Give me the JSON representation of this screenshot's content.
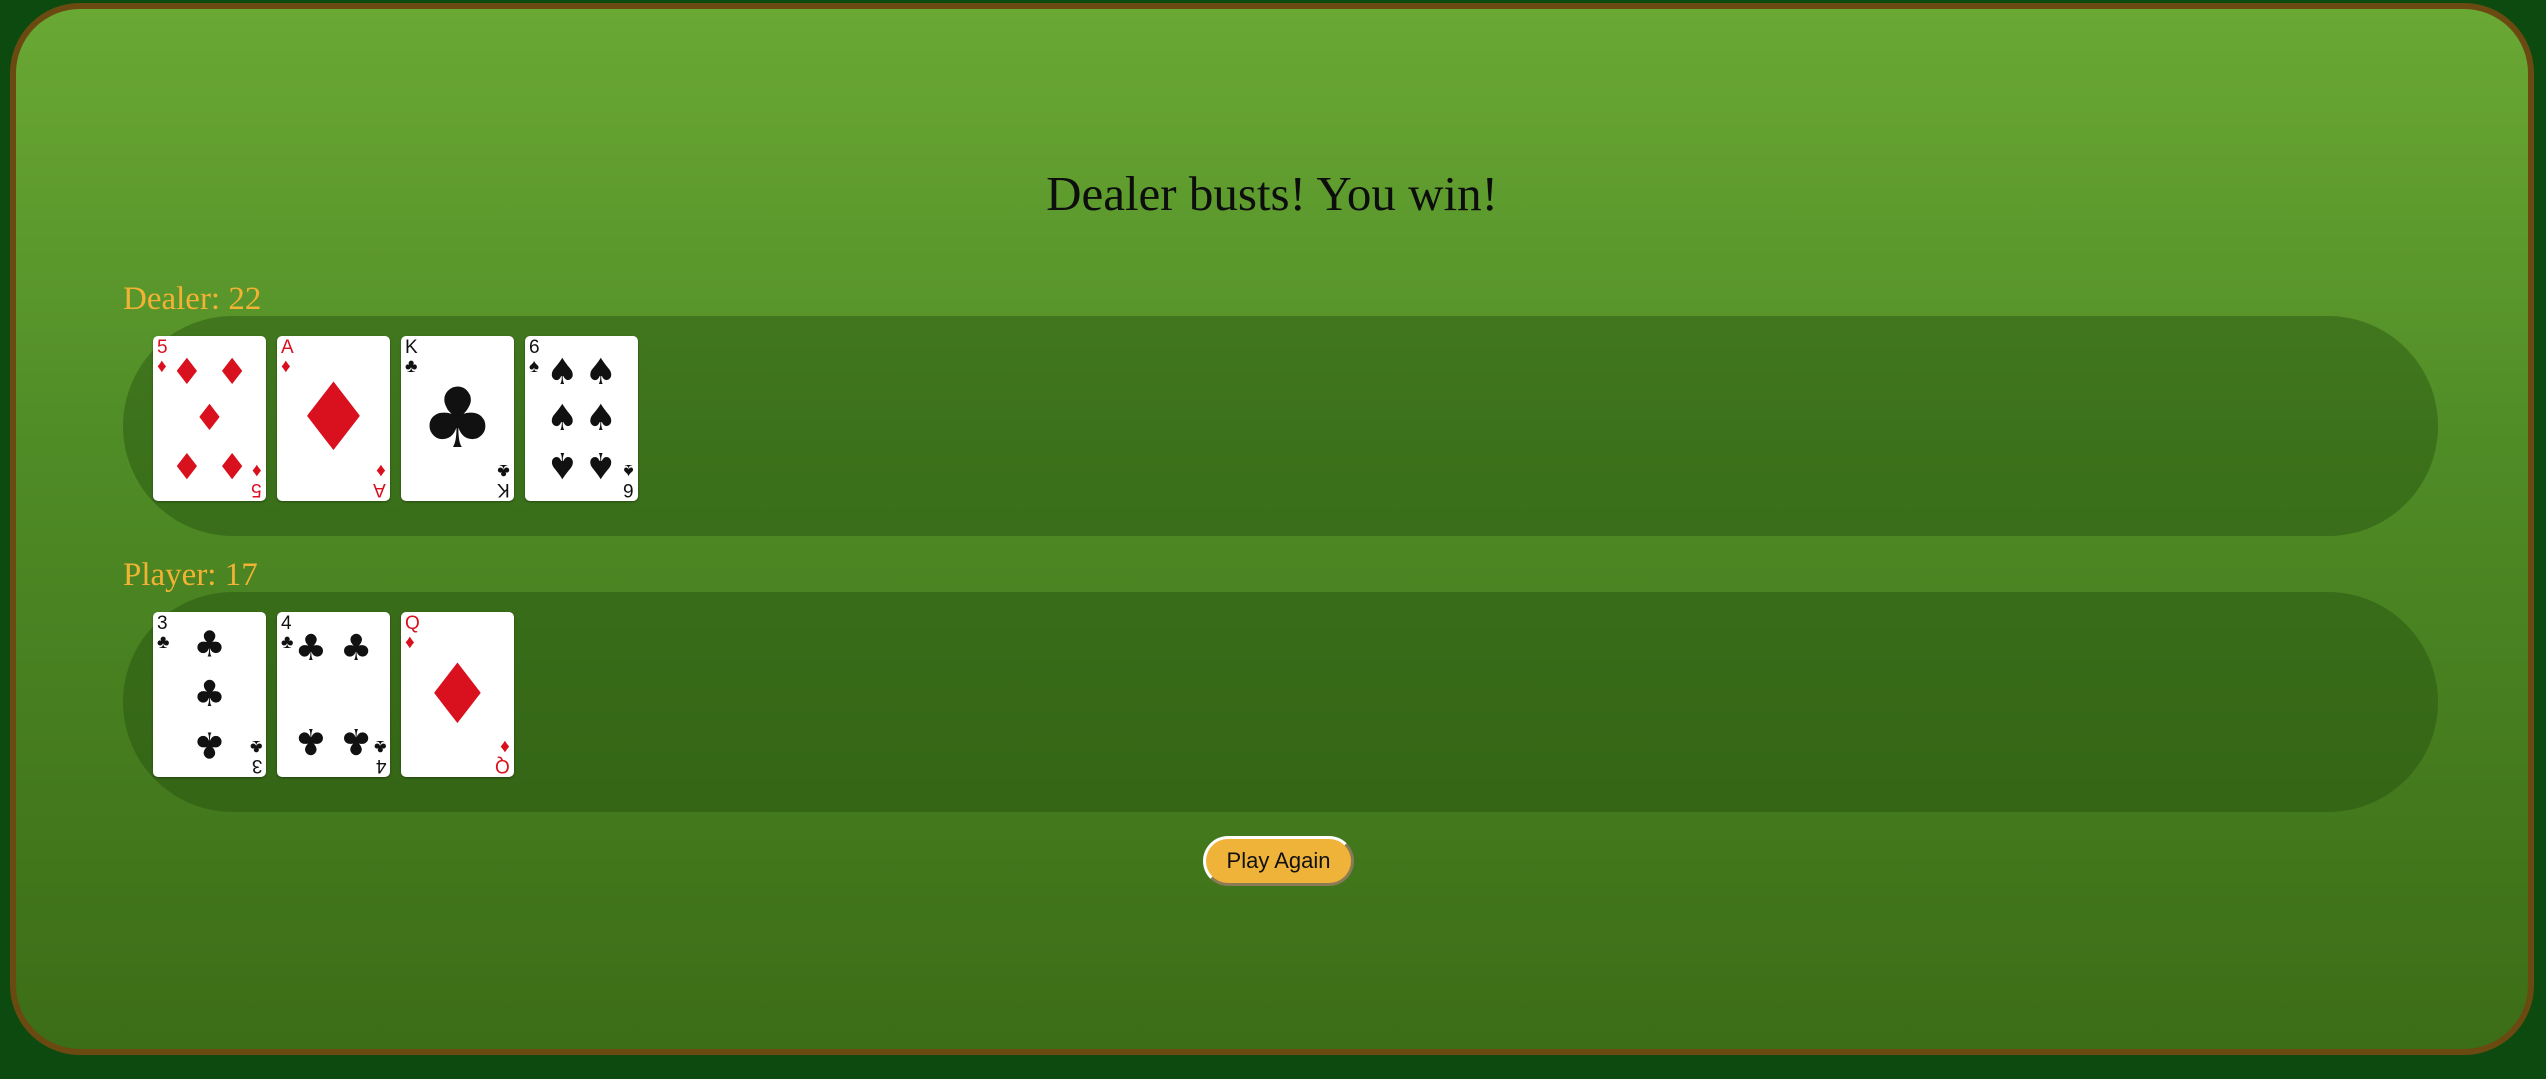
{
  "status_message": "Dealer busts! You win!",
  "dealer": {
    "label": "Dealer: 22",
    "cards": [
      {
        "rank": "5",
        "suit": "diamonds",
        "color": "red"
      },
      {
        "rank": "A",
        "suit": "diamonds",
        "color": "red"
      },
      {
        "rank": "K",
        "suit": "clubs",
        "color": "black"
      },
      {
        "rank": "6",
        "suit": "spades",
        "color": "black"
      }
    ]
  },
  "player": {
    "label": "Player: 17",
    "cards": [
      {
        "rank": "3",
        "suit": "clubs",
        "color": "black"
      },
      {
        "rank": "4",
        "suit": "clubs",
        "color": "black"
      },
      {
        "rank": "Q",
        "suit": "diamonds",
        "color": "red"
      }
    ]
  },
  "controls": {
    "play_again_label": "Play Again"
  },
  "colors": {
    "label": "#f2b233",
    "button": "#f0b33a",
    "red_suit": "#d9101e",
    "black_suit": "#111111"
  }
}
